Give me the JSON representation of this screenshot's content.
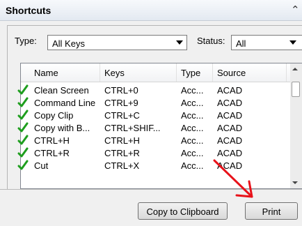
{
  "panel": {
    "title": "Shortcuts"
  },
  "filters": {
    "type_label": "Type:",
    "type_value": "All Keys",
    "status_label": "Status:",
    "status_value": "All"
  },
  "table": {
    "columns": [
      "Name",
      "Keys",
      "Type",
      "Source"
    ],
    "rows": [
      {
        "name": "Clean Screen",
        "keys": "CTRL+0",
        "type": "Acc...",
        "source": "ACAD"
      },
      {
        "name": "Command Line",
        "keys": "CTRL+9",
        "type": "Acc...",
        "source": "ACAD"
      },
      {
        "name": "Copy Clip",
        "keys": "CTRL+C",
        "type": "Acc...",
        "source": "ACAD"
      },
      {
        "name": "Copy with B...",
        "keys": "CTRL+SHIF...",
        "type": "Acc...",
        "source": "ACAD"
      },
      {
        "name": "CTRL+H",
        "keys": "CTRL+H",
        "type": "Acc...",
        "source": "ACAD"
      },
      {
        "name": "CTRL+R",
        "keys": "CTRL+R",
        "type": "Acc...",
        "source": "ACAD"
      },
      {
        "name": "Cut",
        "keys": "CTRL+X",
        "type": "Acc...",
        "source": "ACAD"
      }
    ]
  },
  "buttons": {
    "copy_to_clipboard": "Copy to Clipboard",
    "print": "Print"
  },
  "colors": {
    "check": "#1e9e1e",
    "annotation_arrow": "#e8121a"
  }
}
